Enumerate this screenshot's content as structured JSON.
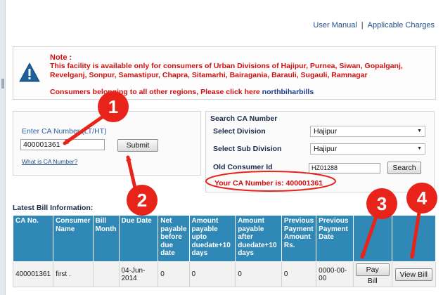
{
  "top_links": {
    "user_manual": "User Manual",
    "separator": "|",
    "applicable_charges": "Applicable Charges"
  },
  "note": {
    "title": "Note :",
    "text": "This facility is available only for consumers of Urban Divisions of Hajipur, Purnea, Siwan, Gopalganj, Revelganj, Sonpur, Samastipur, Chapra, Sitamarhi, Bairagania, Barauli, Sugauli, Ramnagar",
    "other_regions": "Consumers belonging to all other regions, Please click here",
    "other_link": "northbiharbills",
    "icon": "warning-icon"
  },
  "ca_form": {
    "label": "Enter CA Number (LT/HT)",
    "value": "400001361",
    "submit_label": "Submit",
    "what_link": "What is CA Number?"
  },
  "search_ca": {
    "title": "Search CA Number",
    "division_label": "Select Division",
    "division_value": "Hajipur",
    "sub_division_label": "Select Sub Division",
    "sub_division_value": "Hajipur",
    "old_consumer_label": "Old Consumer Id",
    "old_consumer_value": "HZ01288",
    "search_label": "Search",
    "result": "Your CA Number is: 400001361"
  },
  "latest": {
    "title": "Latest Bill Information:",
    "headers": [
      "CA No.",
      "Consumer Name",
      "Bill Month",
      "Due Date",
      "Net payable before due date",
      "Amount payable upto duedate+10 days",
      "Amount payable after duedate+10 days",
      "Previous Payment Amount Rs.",
      "Previous Payment Date",
      "",
      ""
    ],
    "row": [
      "400001361",
      "first .",
      "",
      "04-Jun-2014",
      "0",
      "0",
      "0",
      "0",
      "0000-00-00"
    ],
    "pay_bill": "Pay Bill",
    "view_bill": "View Bill"
  },
  "annotations": {
    "badge_1": "1",
    "badge_2": "2",
    "badge_3": "3",
    "badge_4": "4",
    "color": "#e8231a"
  },
  "colors": {
    "table_header": "#2f88b6",
    "note_red": "#d01010",
    "link_blue": "#1f4f8b"
  }
}
